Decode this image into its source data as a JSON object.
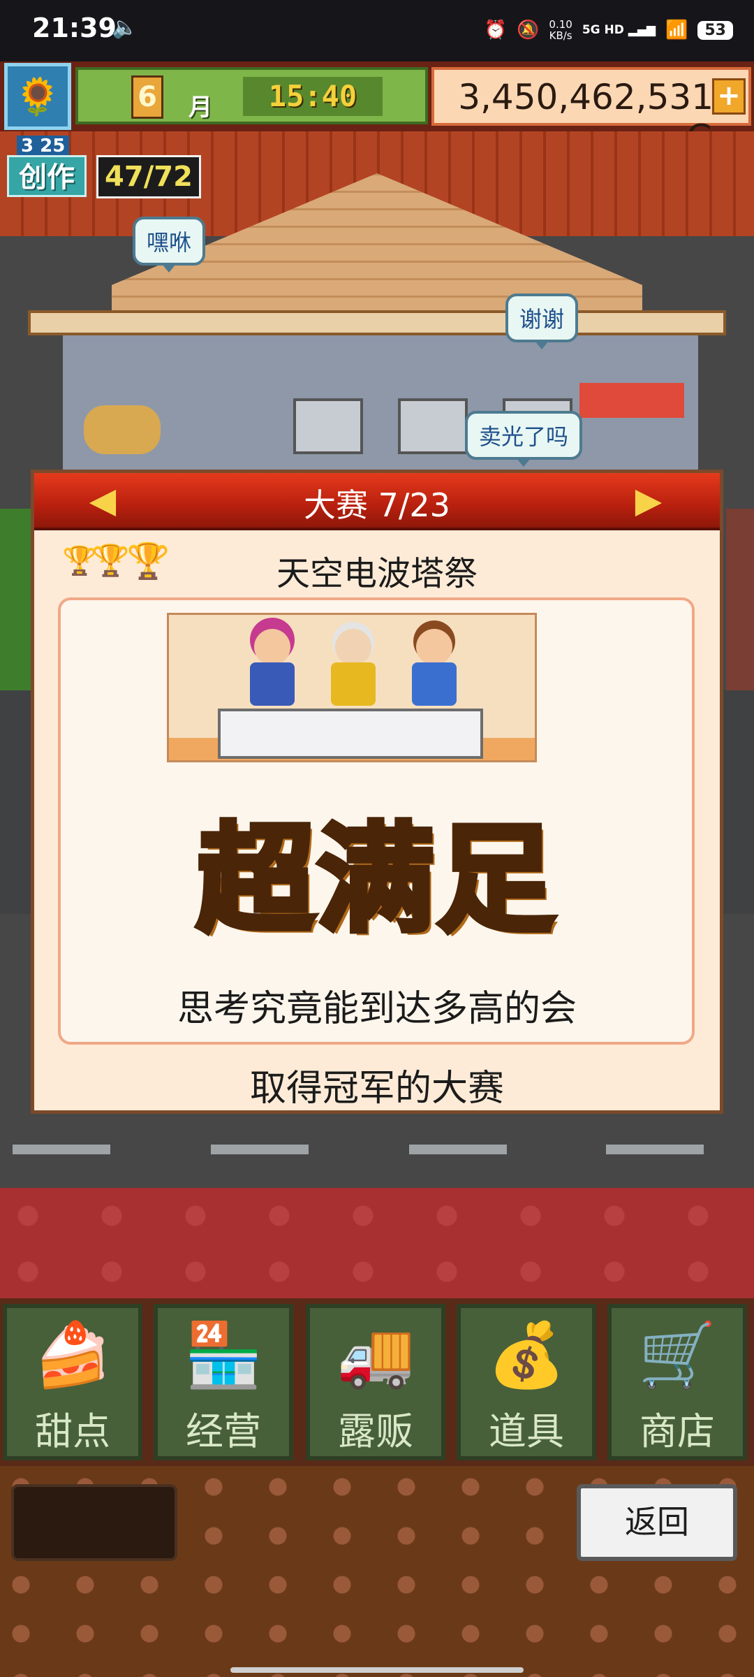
{
  "status_bar": {
    "time": "21:39",
    "network_speed_value": "0.10",
    "network_speed_unit": "KB/s",
    "network_type": "5G HD",
    "battery": "53"
  },
  "hud": {
    "month_number": "6",
    "month_label": "月",
    "clock": "15:40",
    "money": "3,450,462,531 G",
    "add_button": "+"
  },
  "creation": {
    "level": "3 25",
    "label": "创作",
    "count": "47/72"
  },
  "speech_bubbles": {
    "bubble_1": "嘿咻",
    "bubble_2": "谢谢",
    "bubble_3": "卖光了吗"
  },
  "contest_dialog": {
    "title": "大赛 7/23",
    "competition_name": "天空电波塔祭",
    "result_text": "超满足",
    "description_line1": "思考究竟能到达多高的会",
    "description_line2": "取得冠军的大赛",
    "colors": {
      "header": "#c8260f",
      "result_fill": "#f6c055",
      "panel_border": "#f0a887"
    }
  },
  "menu_tabs": [
    {
      "label": "甜点",
      "icon": "cake-icon"
    },
    {
      "label": "经营",
      "icon": "shop-icon"
    },
    {
      "label": "露贩",
      "icon": "food-truck-icon"
    },
    {
      "label": "道具",
      "icon": "items-bag-icon"
    },
    {
      "label": "商店",
      "icon": "shopping-cart-icon"
    }
  ],
  "footer": {
    "back_button": "返回"
  }
}
